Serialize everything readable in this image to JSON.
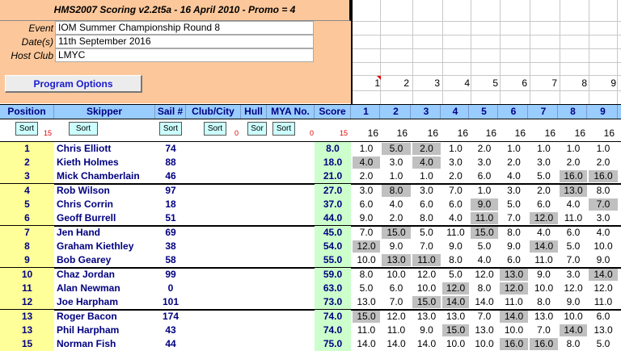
{
  "banner": {
    "title": "HMS2007 Scoring v2.2t5a - 16 April 2010 - Promo = 4"
  },
  "event_info": [
    {
      "label": "Event",
      "value": "IOM Summer Championship Round 8"
    },
    {
      "label": "Date(s)",
      "value": "11th September 2016"
    },
    {
      "label": "Host Club",
      "value": "LMYC"
    }
  ],
  "program_options_label": "Program Options",
  "race_numbers_top": [
    "1",
    "2",
    "3",
    "4",
    "5",
    "6",
    "7",
    "8",
    "9"
  ],
  "columns": {
    "position": "Position",
    "skipper": "Skipper",
    "sail": "Sail #",
    "club": "Club/City",
    "hull": "Hull",
    "mya": "MYA No.",
    "score": "Score",
    "races": [
      "1",
      "2",
      "3",
      "4",
      "5",
      "6",
      "7",
      "8",
      "9"
    ]
  },
  "sort_labels": {
    "position": "Sort",
    "skipper": "Sort",
    "sail": "Sort",
    "club": "Sort",
    "hull": "Sor",
    "mya": "Sort"
  },
  "counts": {
    "position": "15",
    "club": "0",
    "mya": "0",
    "score": "15"
  },
  "race_counts": [
    "16",
    "16",
    "16",
    "16",
    "16",
    "16",
    "16",
    "16",
    "16"
  ],
  "rows": [
    {
      "pos": "1",
      "skipper": "Chris Elliott",
      "sail": "74",
      "score": "8.0",
      "races": [
        "1.0",
        "5.0",
        "2.0",
        "1.0",
        "2.0",
        "1.0",
        "1.0",
        "1.0",
        "1.0"
      ],
      "discards": [
        1,
        2
      ]
    },
    {
      "pos": "2",
      "skipper": "Kieth Holmes",
      "sail": "88",
      "score": "18.0",
      "races": [
        "4.0",
        "3.0",
        "4.0",
        "3.0",
        "3.0",
        "2.0",
        "3.0",
        "2.0",
        "2.0"
      ],
      "discards": [
        0,
        2
      ]
    },
    {
      "pos": "3",
      "skipper": "Mick Chamberlain",
      "sail": "46",
      "score": "21.0",
      "races": [
        "2.0",
        "1.0",
        "1.0",
        "2.0",
        "6.0",
        "4.0",
        "5.0",
        "16.0",
        "16.0"
      ],
      "discards": [
        7,
        8
      ]
    },
    {
      "pos": "4",
      "skipper": "Rob Wilson",
      "sail": "97",
      "score": "27.0",
      "races": [
        "3.0",
        "8.0",
        "3.0",
        "7.0",
        "1.0",
        "3.0",
        "2.0",
        "13.0",
        "8.0"
      ],
      "discards": [
        1,
        7
      ]
    },
    {
      "pos": "5",
      "skipper": "Chris Corrin",
      "sail": "18",
      "score": "37.0",
      "races": [
        "6.0",
        "4.0",
        "6.0",
        "6.0",
        "9.0",
        "5.0",
        "6.0",
        "4.0",
        "7.0"
      ],
      "discards": [
        4,
        8
      ]
    },
    {
      "pos": "6",
      "skipper": "Geoff Burrell",
      "sail": "51",
      "score": "44.0",
      "races": [
        "9.0",
        "2.0",
        "8.0",
        "4.0",
        "11.0",
        "7.0",
        "12.0",
        "11.0",
        "3.0"
      ],
      "discards": [
        4,
        6
      ]
    },
    {
      "pos": "7",
      "skipper": "Jen Hand",
      "sail": "69",
      "score": "45.0",
      "races": [
        "7.0",
        "15.0",
        "5.0",
        "11.0",
        "15.0",
        "8.0",
        "4.0",
        "6.0",
        "4.0"
      ],
      "discards": [
        1,
        4
      ]
    },
    {
      "pos": "8",
      "skipper": "Graham Kiethley",
      "sail": "38",
      "score": "54.0",
      "races": [
        "12.0",
        "9.0",
        "7.0",
        "9.0",
        "5.0",
        "9.0",
        "14.0",
        "5.0",
        "10.0"
      ],
      "discards": [
        0,
        6
      ]
    },
    {
      "pos": "9",
      "skipper": "Bob Gearey",
      "sail": "58",
      "score": "55.0",
      "races": [
        "10.0",
        "13.0",
        "11.0",
        "8.0",
        "4.0",
        "6.0",
        "11.0",
        "7.0",
        "9.0"
      ],
      "discards": [
        1,
        2
      ]
    },
    {
      "pos": "10",
      "skipper": "Chaz Jordan",
      "sail": "99",
      "score": "59.0",
      "races": [
        "8.0",
        "10.0",
        "12.0",
        "5.0",
        "12.0",
        "13.0",
        "9.0",
        "3.0",
        "14.0"
      ],
      "discards": [
        5,
        8
      ]
    },
    {
      "pos": "11",
      "skipper": "Alan Newman",
      "sail": "0",
      "score": "63.0",
      "races": [
        "5.0",
        "6.0",
        "10.0",
        "12.0",
        "8.0",
        "12.0",
        "10.0",
        "12.0",
        "12.0"
      ],
      "discards": [
        3,
        5
      ]
    },
    {
      "pos": "12",
      "skipper": "Joe Harpham",
      "sail": "101",
      "score": "73.0",
      "races": [
        "13.0",
        "7.0",
        "15.0",
        "14.0",
        "14.0",
        "11.0",
        "8.0",
        "9.0",
        "11.0"
      ],
      "discards": [
        2,
        3
      ]
    },
    {
      "pos": "13",
      "skipper": "Roger Bacon",
      "sail": "174",
      "score": "74.0",
      "races": [
        "15.0",
        "12.0",
        "13.0",
        "13.0",
        "7.0",
        "14.0",
        "13.0",
        "10.0",
        "6.0"
      ],
      "discards": [
        0,
        5
      ]
    },
    {
      "pos": "13",
      "skipper": "Phil Harpham",
      "sail": "43",
      "score": "74.0",
      "races": [
        "11.0",
        "11.0",
        "9.0",
        "15.0",
        "13.0",
        "10.0",
        "7.0",
        "14.0",
        "13.0"
      ],
      "discards": [
        3,
        7
      ]
    },
    {
      "pos": "15",
      "skipper": "Norman Fish",
      "sail": "44",
      "score": "75.0",
      "races": [
        "14.0",
        "14.0",
        "14.0",
        "10.0",
        "10.0",
        "16.0",
        "16.0",
        "8.0",
        "5.0"
      ],
      "discards": [
        5,
        6
      ]
    }
  ],
  "colors": {
    "header_bg": "#99ccff",
    "position_bg": "#ffff99",
    "score_bg": "#ccffcc",
    "discard_bg": "#c0c0c0",
    "panel_bg": "#fcc89b",
    "text_blue": "#000080"
  }
}
